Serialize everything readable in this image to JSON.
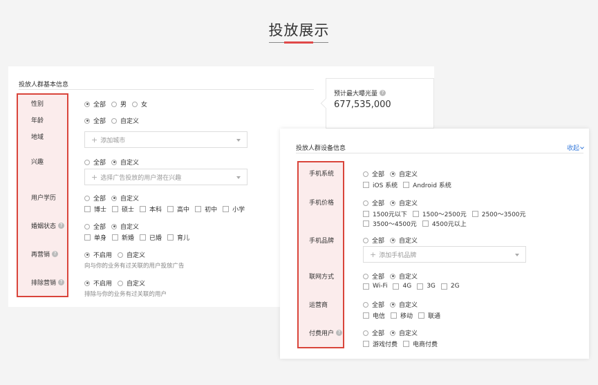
{
  "page": {
    "title": "投放展示"
  },
  "basic": {
    "title": "投放人群基本信息",
    "gender": {
      "label": "性别",
      "options": [
        "全部",
        "男",
        "女"
      ]
    },
    "age": {
      "label": "年龄",
      "options": [
        "全部",
        "自定义"
      ]
    },
    "region": {
      "label": "地域",
      "placeholder": "添加城市"
    },
    "interest": {
      "label": "兴趣",
      "options": [
        "全部",
        "自定义"
      ],
      "placeholder": "选择广告投放的用户潜在兴趣"
    },
    "education": {
      "label": "用户学历",
      "options": [
        "全部",
        "自定义"
      ],
      "checks": [
        "博士",
        "硕士",
        "本科",
        "高中",
        "初中",
        "小学"
      ]
    },
    "marital": {
      "label": "婚姻状态",
      "options": [
        "全部",
        "自定义"
      ],
      "checks": [
        "单身",
        "新婚",
        "已婚",
        "育儿"
      ]
    },
    "remarketing": {
      "label": "再营销",
      "options": [
        "不启用",
        "自定义"
      ],
      "hint": "向与你的业务有过关联的用户投放广告"
    },
    "exclude": {
      "label": "排除营销",
      "options": [
        "不启用",
        "自定义"
      ],
      "hint": "排除与你的业务有过关联的用户"
    }
  },
  "reach": {
    "label": "预计最大曝光量",
    "value": "677,535,000"
  },
  "device": {
    "title": "投放人群设备信息",
    "collapse": "收起",
    "os": {
      "label": "手机系统",
      "options": [
        "全部",
        "自定义"
      ],
      "checks": [
        "iOS 系统",
        "Android 系统"
      ]
    },
    "price": {
      "label": "手机价格",
      "options": [
        "全部",
        "自定义"
      ],
      "checks1": [
        "1500元以下",
        "1500～2500元",
        "2500～3500元"
      ],
      "checks2": [
        "3500～4500元",
        "4500元以上"
      ]
    },
    "brand": {
      "label": "手机品牌",
      "options": [
        "全部",
        "自定义"
      ],
      "placeholder": "添加手机品牌"
    },
    "network": {
      "label": "联网方式",
      "options": [
        "全部",
        "自定义"
      ],
      "checks": [
        "Wi-Fi",
        "4G",
        "3G",
        "2G"
      ]
    },
    "carrier": {
      "label": "运营商",
      "options": [
        "全部",
        "自定义"
      ],
      "checks": [
        "电信",
        "移动",
        "联通"
      ]
    },
    "paying": {
      "label": "付费用户",
      "options": [
        "全部",
        "自定义"
      ],
      "checks": [
        "游戏付费",
        "电商付费"
      ]
    }
  }
}
